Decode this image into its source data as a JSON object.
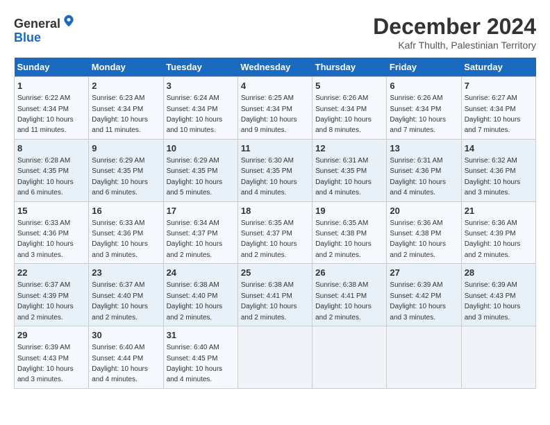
{
  "header": {
    "logo_general": "General",
    "logo_blue": "Blue",
    "month_title": "December 2024",
    "location": "Kafr Thulth, Palestinian Territory"
  },
  "days_of_week": [
    "Sunday",
    "Monday",
    "Tuesday",
    "Wednesday",
    "Thursday",
    "Friday",
    "Saturday"
  ],
  "weeks": [
    [
      {
        "day": "1",
        "sunrise": "6:22 AM",
        "sunset": "4:34 PM",
        "daylight": "10 hours and 11 minutes."
      },
      {
        "day": "2",
        "sunrise": "6:23 AM",
        "sunset": "4:34 PM",
        "daylight": "10 hours and 11 minutes."
      },
      {
        "day": "3",
        "sunrise": "6:24 AM",
        "sunset": "4:34 PM",
        "daylight": "10 hours and 10 minutes."
      },
      {
        "day": "4",
        "sunrise": "6:25 AM",
        "sunset": "4:34 PM",
        "daylight": "10 hours and 9 minutes."
      },
      {
        "day": "5",
        "sunrise": "6:26 AM",
        "sunset": "4:34 PM",
        "daylight": "10 hours and 8 minutes."
      },
      {
        "day": "6",
        "sunrise": "6:26 AM",
        "sunset": "4:34 PM",
        "daylight": "10 hours and 7 minutes."
      },
      {
        "day": "7",
        "sunrise": "6:27 AM",
        "sunset": "4:34 PM",
        "daylight": "10 hours and 7 minutes."
      }
    ],
    [
      {
        "day": "8",
        "sunrise": "6:28 AM",
        "sunset": "4:35 PM",
        "daylight": "10 hours and 6 minutes."
      },
      {
        "day": "9",
        "sunrise": "6:29 AM",
        "sunset": "4:35 PM",
        "daylight": "10 hours and 6 minutes."
      },
      {
        "day": "10",
        "sunrise": "6:29 AM",
        "sunset": "4:35 PM",
        "daylight": "10 hours and 5 minutes."
      },
      {
        "day": "11",
        "sunrise": "6:30 AM",
        "sunset": "4:35 PM",
        "daylight": "10 hours and 4 minutes."
      },
      {
        "day": "12",
        "sunrise": "6:31 AM",
        "sunset": "4:35 PM",
        "daylight": "10 hours and 4 minutes."
      },
      {
        "day": "13",
        "sunrise": "6:31 AM",
        "sunset": "4:36 PM",
        "daylight": "10 hours and 4 minutes."
      },
      {
        "day": "14",
        "sunrise": "6:32 AM",
        "sunset": "4:36 PM",
        "daylight": "10 hours and 3 minutes."
      }
    ],
    [
      {
        "day": "15",
        "sunrise": "6:33 AM",
        "sunset": "4:36 PM",
        "daylight": "10 hours and 3 minutes."
      },
      {
        "day": "16",
        "sunrise": "6:33 AM",
        "sunset": "4:36 PM",
        "daylight": "10 hours and 3 minutes."
      },
      {
        "day": "17",
        "sunrise": "6:34 AM",
        "sunset": "4:37 PM",
        "daylight": "10 hours and 2 minutes."
      },
      {
        "day": "18",
        "sunrise": "6:35 AM",
        "sunset": "4:37 PM",
        "daylight": "10 hours and 2 minutes."
      },
      {
        "day": "19",
        "sunrise": "6:35 AM",
        "sunset": "4:38 PM",
        "daylight": "10 hours and 2 minutes."
      },
      {
        "day": "20",
        "sunrise": "6:36 AM",
        "sunset": "4:38 PM",
        "daylight": "10 hours and 2 minutes."
      },
      {
        "day": "21",
        "sunrise": "6:36 AM",
        "sunset": "4:39 PM",
        "daylight": "10 hours and 2 minutes."
      }
    ],
    [
      {
        "day": "22",
        "sunrise": "6:37 AM",
        "sunset": "4:39 PM",
        "daylight": "10 hours and 2 minutes."
      },
      {
        "day": "23",
        "sunrise": "6:37 AM",
        "sunset": "4:40 PM",
        "daylight": "10 hours and 2 minutes."
      },
      {
        "day": "24",
        "sunrise": "6:38 AM",
        "sunset": "4:40 PM",
        "daylight": "10 hours and 2 minutes."
      },
      {
        "day": "25",
        "sunrise": "6:38 AM",
        "sunset": "4:41 PM",
        "daylight": "10 hours and 2 minutes."
      },
      {
        "day": "26",
        "sunrise": "6:38 AM",
        "sunset": "4:41 PM",
        "daylight": "10 hours and 2 minutes."
      },
      {
        "day": "27",
        "sunrise": "6:39 AM",
        "sunset": "4:42 PM",
        "daylight": "10 hours and 3 minutes."
      },
      {
        "day": "28",
        "sunrise": "6:39 AM",
        "sunset": "4:43 PM",
        "daylight": "10 hours and 3 minutes."
      }
    ],
    [
      {
        "day": "29",
        "sunrise": "6:39 AM",
        "sunset": "4:43 PM",
        "daylight": "10 hours and 3 minutes."
      },
      {
        "day": "30",
        "sunrise": "6:40 AM",
        "sunset": "4:44 PM",
        "daylight": "10 hours and 4 minutes."
      },
      {
        "day": "31",
        "sunrise": "6:40 AM",
        "sunset": "4:45 PM",
        "daylight": "10 hours and 4 minutes."
      },
      null,
      null,
      null,
      null
    ]
  ]
}
